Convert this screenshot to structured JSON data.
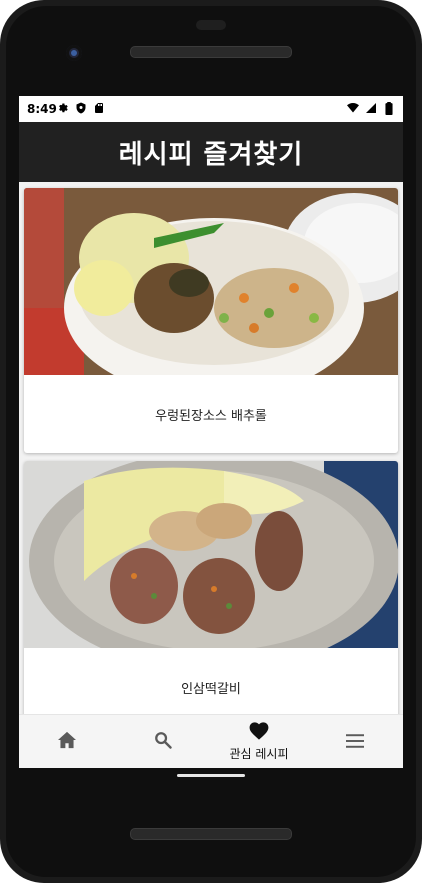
{
  "status_bar": {
    "time": "8:49",
    "icons": [
      "settings-icon",
      "shield-icon",
      "sd-card-icon",
      "wifi-icon",
      "signal-icon",
      "battery-icon"
    ]
  },
  "app_bar": {
    "title": "레시피 즐겨찾기"
  },
  "recipes": [
    {
      "name": "우렁된장소스 배추롤"
    },
    {
      "name": "인삼떡갈비"
    }
  ],
  "bottom_nav": {
    "items": [
      {
        "icon": "home-icon"
      },
      {
        "icon": "search-icon"
      },
      {
        "icon": "heart-icon",
        "label": "관심 레시피",
        "selected": true
      },
      {
        "icon": "menu-icon"
      }
    ]
  },
  "colors": {
    "app_bar": "#212121",
    "status_text": "#000000",
    "nav_background": "#f5f5f5"
  }
}
